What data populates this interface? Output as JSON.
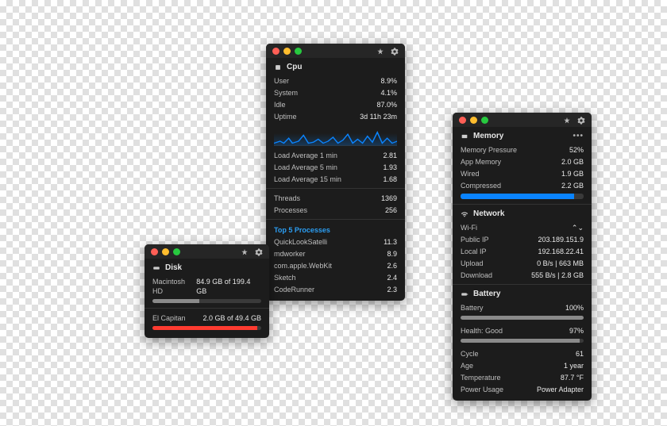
{
  "colors": {
    "panel_bg": "#1c1c1c",
    "accent_blue": "#0a84ff",
    "danger_red": "#ff3b30",
    "traffic_red": "#ff5f56",
    "traffic_yellow": "#ffbd2e",
    "traffic_green": "#27c93f"
  },
  "cpu": {
    "title": "Cpu",
    "stats": {
      "user": {
        "label": "User",
        "value": "8.9%"
      },
      "system": {
        "label": "System",
        "value": "4.1%"
      },
      "idle": {
        "label": "Idle",
        "value": "87.0%"
      },
      "uptime": {
        "label": "Uptime",
        "value": "3d 11h 23m"
      }
    },
    "load": {
      "l1": {
        "label": "Load Average 1 min",
        "value": "2.81"
      },
      "l5": {
        "label": "Load Average 5 min",
        "value": "1.93"
      },
      "l15": {
        "label": "Load Average 15 min",
        "value": "1.68"
      }
    },
    "counts": {
      "threads": {
        "label": "Threads",
        "value": "1369"
      },
      "processes": {
        "label": "Processes",
        "value": "256"
      }
    },
    "top_title": "Top 5 Processes",
    "top": [
      {
        "name": "QuickLookSatelli",
        "value": "11.3"
      },
      {
        "name": "mdworker",
        "value": "8.9"
      },
      {
        "name": "com.apple.WebKit",
        "value": "2.6"
      },
      {
        "name": "Sketch",
        "value": "2.4"
      },
      {
        "name": "CodeRunner",
        "value": "2.3"
      }
    ]
  },
  "disk": {
    "title": "Disk",
    "volumes": [
      {
        "name": "Macintosh HD",
        "usage_text": "84.9 GB of 199.4 GB",
        "fill_pct": 43,
        "color": "grey"
      },
      {
        "name": "El Capitan",
        "usage_text": "2.0 GB of 49.4 GB",
        "fill_pct": 96,
        "color": "red"
      }
    ]
  },
  "memory": {
    "title": "Memory",
    "rows": {
      "pressure": {
        "label": "Memory Pressure",
        "value": "52%"
      },
      "app": {
        "label": "App Memory",
        "value": "2.0 GB"
      },
      "wired": {
        "label": "Wired",
        "value": "1.9 GB"
      },
      "compressed": {
        "label": "Compressed",
        "value": "2.2 GB"
      }
    },
    "bar_pct": 92
  },
  "network": {
    "title": "Network",
    "interface_label": "Wi-Fi",
    "rows": {
      "public_ip": {
        "label": "Public IP",
        "value": "203.189.151.9"
      },
      "local_ip": {
        "label": "Local IP",
        "value": "192.168.22.41"
      },
      "upload": {
        "label": "Upload",
        "value": "0 B/s  |  663 MB"
      },
      "download": {
        "label": "Download",
        "value": "555 B/s  |  2.8 GB"
      }
    }
  },
  "battery": {
    "title": "Battery",
    "rows": {
      "battery": {
        "label": "Battery",
        "value": "100%"
      },
      "health": {
        "label": "Health: Good",
        "value": "97%"
      },
      "cycle": {
        "label": "Cycle",
        "value": "61"
      },
      "age": {
        "label": "Age",
        "value": "1 year"
      },
      "temp": {
        "label": "Temperature",
        "value": "87.7 °F"
      },
      "power": {
        "label": "Power Usage",
        "value": "Power Adapter"
      }
    },
    "battery_bar_pct": 100,
    "health_bar_pct": 97
  }
}
